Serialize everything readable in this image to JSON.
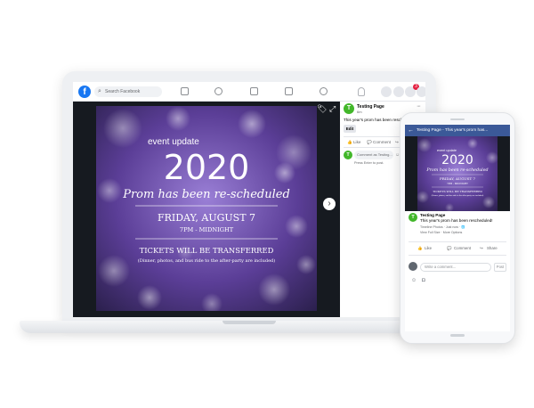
{
  "laptop": {
    "topbar": {
      "search_placeholder": "Search Facebook",
      "notification_count": "3"
    },
    "flyer": {
      "line1": "event update",
      "year": "2020",
      "script": "Prom has been re-scheduled",
      "date": "FRIDAY, AUGUST 7",
      "time": "7PM - MIDNIGHT",
      "tickets": "TICKETS WILL BE TRANSFERRED",
      "note": "(Dinner, photos, and bus ride to the after-party are included)"
    },
    "side": {
      "avatar_letter": "T",
      "page_name": "Testing Page",
      "time": "6m",
      "post_text": "This year's prom has been rescheduled!",
      "edit_label": "Edit",
      "like_label": "Like",
      "comment_label": "Comment",
      "comment_placeholder": "Comment as Testing...",
      "hint": "Press Enter to post."
    }
  },
  "phone": {
    "title": "Testing Page - This year's prom has...",
    "flyer": {
      "line1": "event update",
      "year": "2020",
      "script": "Prom has been re-scheduled",
      "date": "FRIDAY, AUGUST 7",
      "time": "7PM - MIDNIGHT",
      "tickets": "TICKETS WILL BE TRANSFERRED",
      "note": "(Dinner, photos, and bus ride to the after-party are included)"
    },
    "avatar_letter": "T",
    "page_name": "Testing Page",
    "post_text": "This year's prom has been rescheduled!",
    "meta1": "Timeline Photos · Just now · ",
    "meta2": "View Full Size · More Options",
    "like_label": "Like",
    "comment_label": "Comment",
    "share_label": "Share",
    "comment_placeholder": "Write a comment...",
    "post_button": "Post"
  }
}
